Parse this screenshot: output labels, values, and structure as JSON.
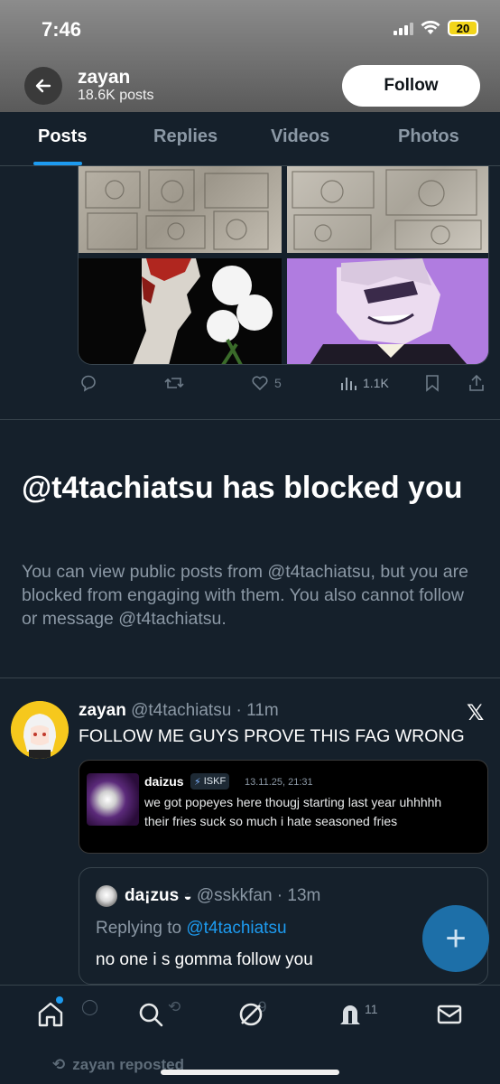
{
  "status_bar": {
    "time": "7:46",
    "battery": "20"
  },
  "header": {
    "name": "zayan",
    "posts_count": "18.6K posts",
    "follow_label": "Follow"
  },
  "tabs": [
    {
      "label": "Posts",
      "active": true
    },
    {
      "label": "Replies",
      "active": false
    },
    {
      "label": "Videos",
      "active": false
    },
    {
      "label": "Photos",
      "active": false
    }
  ],
  "prev_post": {
    "likes": "5",
    "views": "1.1K"
  },
  "blocked": {
    "title": "@t4tachiatsu has blocked you",
    "description": "You can view public posts from @t4tachiatsu, but you are blocked from engaging with them. You also cannot follow or message @t4tachiatsu."
  },
  "post": {
    "name": "zayan",
    "handle_time": "@t4tachiatsu · 11m",
    "text": "FOLLOW ME GUYS PROVE THIS FAG WRONG",
    "quoted_image": {
      "name": "daizus",
      "badge": "ISKF",
      "time": "13.11.25, 21:31",
      "text": "we got popeyes here thougj starting last year uhhhhh their fries suck so much i hate seasoned fries"
    },
    "reply": {
      "name": "da¡zus",
      "handle_time": "@sskkfan · 13m",
      "replying_prefix": "Replying to ",
      "replying_to": "@t4tachiatsu",
      "text": "no one i s gomma follow you"
    }
  },
  "behind_nav": {
    "reply_count": "9",
    "views": "11"
  },
  "peek": {
    "repost_label": "zayan reposted"
  },
  "colors": {
    "accent": "#1d9bf0",
    "bg": "#15202b",
    "muted": "#8b98a5"
  }
}
